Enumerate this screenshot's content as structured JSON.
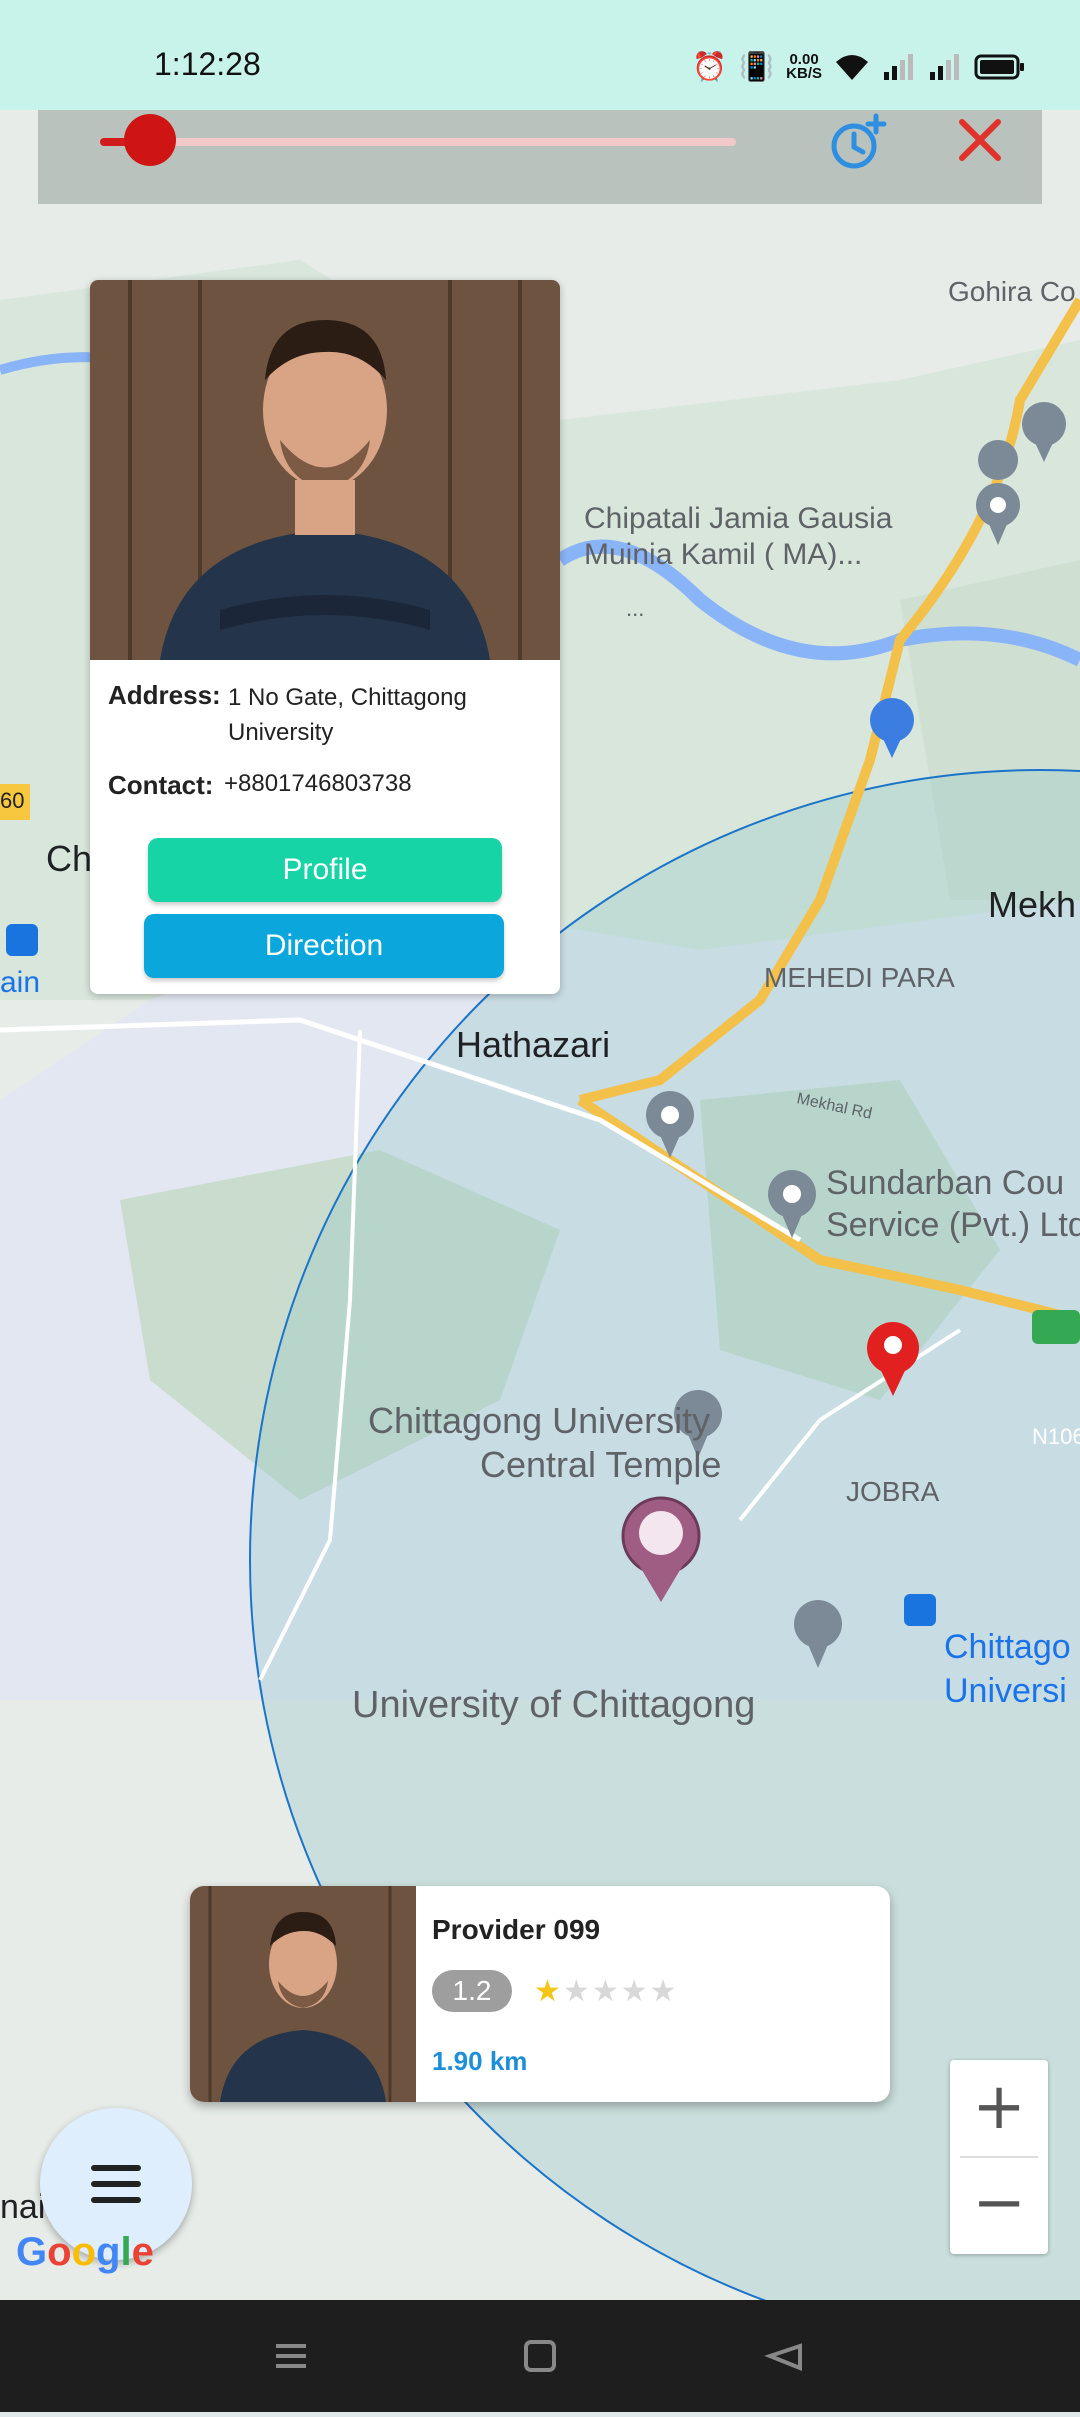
{
  "status_bar": {
    "time": "1:12:28",
    "speed_value": "0.00",
    "speed_unit": "KB/S",
    "icons": [
      "alarm-icon",
      "vibrate-icon",
      "wifi-icon",
      "signal-icon",
      "signal-icon-2",
      "battery-icon"
    ]
  },
  "top_controls": {
    "slider_value_fraction": 0.05,
    "history_icon": "clock-plus-icon",
    "close_icon": "close-icon"
  },
  "info_card": {
    "address_label": "Address:",
    "address_value": "1 No Gate, Chittagong University",
    "contact_label": "Contact:",
    "contact_value": "+8801746803738",
    "profile_button": "Profile",
    "direction_button": "Direction"
  },
  "map": {
    "labels": {
      "gohira": "Gohira Co",
      "chipatali_line1": "Chipatali Jamia Gausia",
      "chipatali_line2": "Muinia Kamil ( MA)...",
      "ellipsis": "...",
      "mekh": "Mekh",
      "ch": "Ch",
      "ain": "ain",
      "road_sixty": "60",
      "mehedi_para": "MEHEDI PARA",
      "hathazari": "Hathazari",
      "mekhal_rd": "Mekhal Rd",
      "sundarban_line1": "Sundarban Cou",
      "sundarban_line2": "Service (Pvt.) Ltd",
      "n106": "N106",
      "temple_line1": "Chittagong University",
      "temple_line2": "Central Temple",
      "jobra": "JOBRA",
      "university": "University of Chittagong",
      "chittag_line1": "Chittago",
      "chittag_line2": "Universi",
      "naichhari": "naichhari"
    }
  },
  "provider_card": {
    "name": "Provider 099",
    "rating": "1.2",
    "rating_stars": 1.2,
    "distance": "1.90 km"
  },
  "zoom": {
    "in_label": "+",
    "out_label": "−"
  },
  "google_logo": "Google",
  "colors": {
    "status_bar": "#c8f3ea",
    "profile_button": "#16d4a6",
    "direction_button": "#0aa6dc",
    "slider": "#d01c1c",
    "distance": "#1d8fd8",
    "star_filled": "#f5c518",
    "star_empty": "#d8d8d8"
  }
}
